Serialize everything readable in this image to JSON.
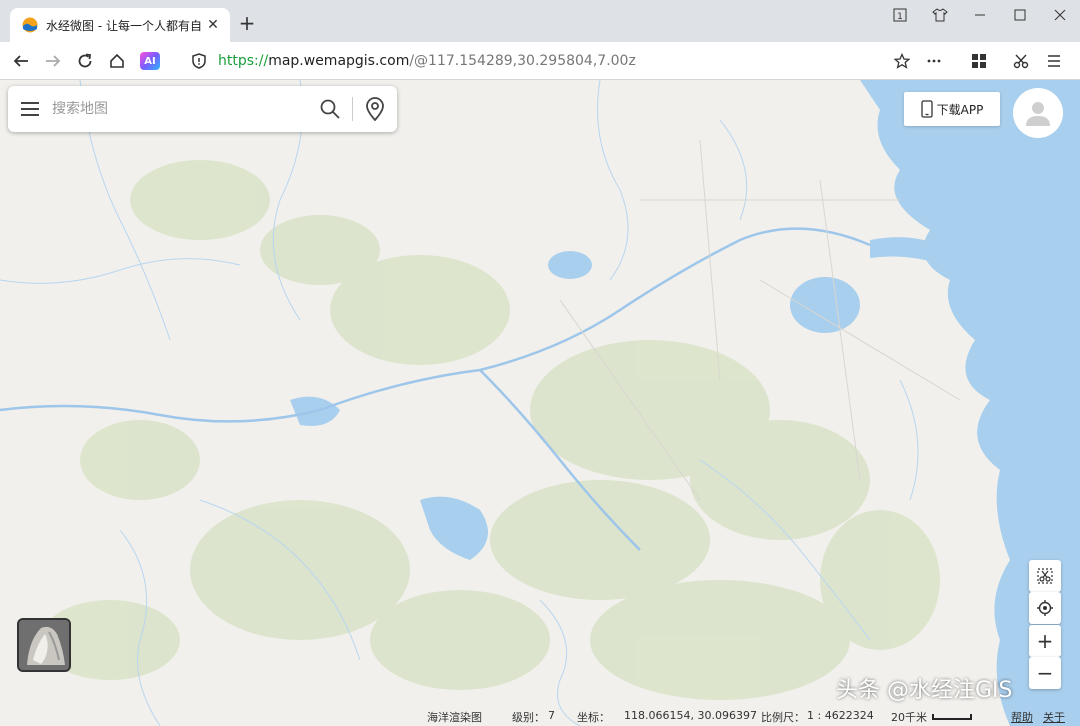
{
  "browser": {
    "tab_title": "水经微图 - 让每一个人都有自",
    "tab_close": "✕",
    "new_tab": "+",
    "url_scheme": "https://",
    "url_host": "map.wemapgis.com",
    "url_path": "/@117.154289,30.295804,7.00z",
    "ai_label": "AI",
    "icons": [
      "back-icon",
      "forward-icon",
      "reload-icon",
      "home-icon",
      "shield-icon",
      "star-icon",
      "more-icon",
      "apps-icon",
      "scissors-icon",
      "menu-icon"
    ],
    "window_controls": [
      "tab-count-icon",
      "shirt-icon",
      "minimize-icon",
      "maximize-icon",
      "close-icon"
    ],
    "tab_count": "1"
  },
  "map": {
    "search_placeholder": "搜索地图",
    "download_label": "下载APP",
    "status": {
      "layer": "海洋渲染图",
      "level_label": "级别：",
      "level_value": "7",
      "coord_label": "坐标：",
      "coord_value": "118.066154, 30.096397",
      "scale_label": "比例尺：",
      "scale_value": "1 : 4622324",
      "scalebar_label": "20千米",
      "help": "帮助",
      "about": "关于"
    },
    "controls": {
      "zoom_in": "+",
      "zoom_out": "−"
    },
    "watermark": "头条 @水经注GIS",
    "colors": {
      "land": "#f1f0ec",
      "sea": "#a9cfee",
      "water": "#a9cfee",
      "forest": "#d6e0c4",
      "secure": "#1a9e3a"
    }
  }
}
